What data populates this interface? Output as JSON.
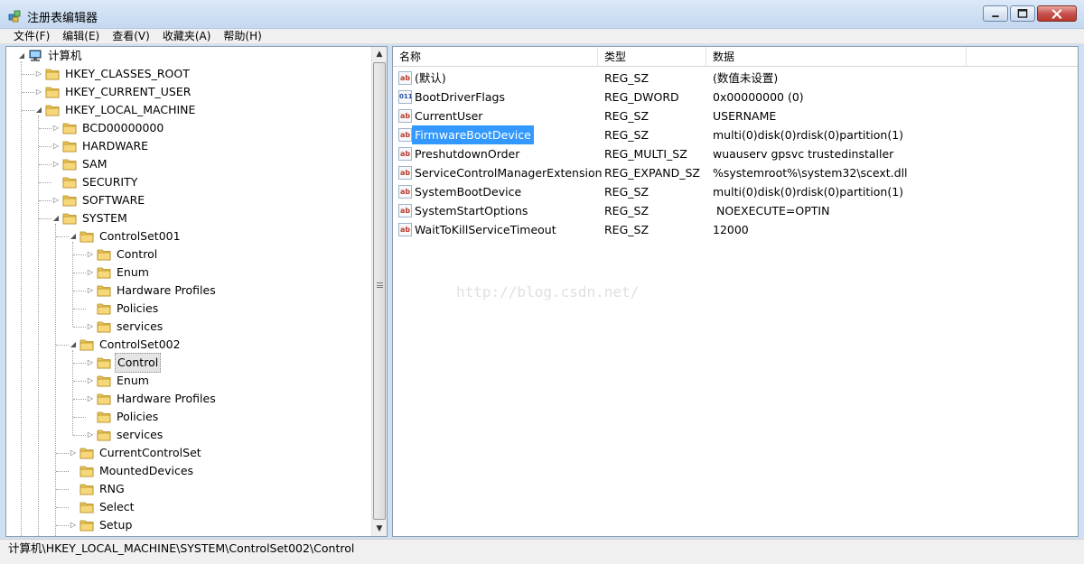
{
  "window": {
    "title": "注册表编辑器",
    "icon": "registry-editor-icon"
  },
  "menu": [
    "文件(F)",
    "编辑(E)",
    "查看(V)",
    "收藏夹(A)",
    "帮助(H)"
  ],
  "tree": {
    "selected_path": "计算机\\HKEY_LOCAL_MACHINE\\SYSTEM\\ControlSet002\\Control",
    "nodes": [
      {
        "label": "计算机",
        "depth": 0,
        "expander": "expanded",
        "icon": "computer-icon"
      },
      {
        "label": "HKEY_CLASSES_ROOT",
        "depth": 1,
        "expander": "collapsed",
        "icon": "folder-icon"
      },
      {
        "label": "HKEY_CURRENT_USER",
        "depth": 1,
        "expander": "collapsed",
        "icon": "folder-icon"
      },
      {
        "label": "HKEY_LOCAL_MACHINE",
        "depth": 1,
        "expander": "expanded",
        "icon": "folder-icon"
      },
      {
        "label": "BCD00000000",
        "depth": 2,
        "expander": "collapsed",
        "icon": "folder-icon"
      },
      {
        "label": "HARDWARE",
        "depth": 2,
        "expander": "collapsed",
        "icon": "folder-icon"
      },
      {
        "label": "SAM",
        "depth": 2,
        "expander": "collapsed",
        "icon": "folder-icon"
      },
      {
        "label": "SECURITY",
        "depth": 2,
        "expander": "none",
        "icon": "folder-icon"
      },
      {
        "label": "SOFTWARE",
        "depth": 2,
        "expander": "collapsed",
        "icon": "folder-icon"
      },
      {
        "label": "SYSTEM",
        "depth": 2,
        "expander": "expanded",
        "icon": "folder-icon"
      },
      {
        "label": "ControlSet001",
        "depth": 3,
        "expander": "expanded",
        "icon": "folder-icon"
      },
      {
        "label": "Control",
        "depth": 4,
        "expander": "collapsed",
        "icon": "folder-icon"
      },
      {
        "label": "Enum",
        "depth": 4,
        "expander": "collapsed",
        "icon": "folder-icon"
      },
      {
        "label": "Hardware Profiles",
        "depth": 4,
        "expander": "collapsed",
        "icon": "folder-icon"
      },
      {
        "label": "Policies",
        "depth": 4,
        "expander": "none",
        "icon": "folder-icon"
      },
      {
        "label": "services",
        "depth": 4,
        "expander": "collapsed",
        "icon": "folder-icon"
      },
      {
        "label": "ControlSet002",
        "depth": 3,
        "expander": "expanded",
        "icon": "folder-icon"
      },
      {
        "label": "Control",
        "depth": 4,
        "expander": "collapsed",
        "icon": "folder-icon",
        "selected": true
      },
      {
        "label": "Enum",
        "depth": 4,
        "expander": "collapsed",
        "icon": "folder-icon"
      },
      {
        "label": "Hardware Profiles",
        "depth": 4,
        "expander": "collapsed",
        "icon": "folder-icon"
      },
      {
        "label": "Policies",
        "depth": 4,
        "expander": "none",
        "icon": "folder-icon"
      },
      {
        "label": "services",
        "depth": 4,
        "expander": "collapsed",
        "icon": "folder-icon"
      },
      {
        "label": "CurrentControlSet",
        "depth": 3,
        "expander": "collapsed",
        "icon": "folder-icon"
      },
      {
        "label": "MountedDevices",
        "depth": 3,
        "expander": "none",
        "icon": "folder-icon"
      },
      {
        "label": "RNG",
        "depth": 3,
        "expander": "none",
        "icon": "folder-icon"
      },
      {
        "label": "Select",
        "depth": 3,
        "expander": "none",
        "icon": "folder-icon"
      },
      {
        "label": "Setup",
        "depth": 3,
        "expander": "collapsed",
        "icon": "folder-icon"
      }
    ]
  },
  "list": {
    "columns": [
      "名称",
      "类型",
      "数据"
    ],
    "rows": [
      {
        "name": "(默认)",
        "type": "REG_SZ",
        "data": "(数值未设置)",
        "icon": "string-value-icon"
      },
      {
        "name": "BootDriverFlags",
        "type": "REG_DWORD",
        "data": "0x00000000 (0)",
        "icon": "binary-value-icon"
      },
      {
        "name": "CurrentUser",
        "type": "REG_SZ",
        "data": "USERNAME",
        "icon": "string-value-icon"
      },
      {
        "name": "FirmwareBootDevice",
        "type": "REG_SZ",
        "data": "multi(0)disk(0)rdisk(0)partition(1)",
        "icon": "string-value-icon",
        "selected": true
      },
      {
        "name": "PreshutdownOrder",
        "type": "REG_MULTI_SZ",
        "data": "wuauserv gpsvc trustedinstaller",
        "icon": "string-value-icon"
      },
      {
        "name": "ServiceControlManagerExtension",
        "type": "REG_EXPAND_SZ",
        "data": "%systemroot%\\system32\\scext.dll",
        "icon": "string-value-icon"
      },
      {
        "name": "SystemBootDevice",
        "type": "REG_SZ",
        "data": "multi(0)disk(0)rdisk(0)partition(1)",
        "icon": "string-value-icon"
      },
      {
        "name": "SystemStartOptions",
        "type": "REG_SZ",
        "data": " NOEXECUTE=OPTIN",
        "icon": "string-value-icon"
      },
      {
        "name": "WaitToKillServiceTimeout",
        "type": "REG_SZ",
        "data": "12000",
        "icon": "string-value-icon"
      }
    ]
  },
  "watermark": "http://blog.csdn.net/",
  "status": {
    "path": "计算机\\HKEY_LOCAL_MACHINE\\SYSTEM\\ControlSet002\\Control"
  }
}
